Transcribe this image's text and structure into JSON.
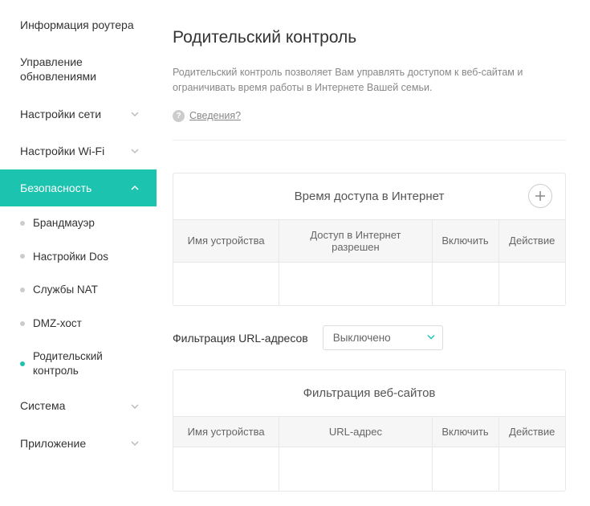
{
  "sidebar": {
    "items": [
      {
        "label": "Информация роутера",
        "type": "plain"
      },
      {
        "label": "Управление обновлениями",
        "type": "plain"
      },
      {
        "label": "Настройки сети",
        "type": "expand"
      },
      {
        "label": "Настройки Wi-Fi",
        "type": "expand"
      },
      {
        "label": "Безопасность",
        "type": "expand",
        "active": true
      },
      {
        "label": "Брандмауэр",
        "type": "sub"
      },
      {
        "label": "Настройки Dos",
        "type": "sub"
      },
      {
        "label": "Службы NAT",
        "type": "sub"
      },
      {
        "label": "DMZ-хост",
        "type": "sub"
      },
      {
        "label": "Родительский контроль",
        "type": "sub",
        "current": true
      },
      {
        "label": "Система",
        "type": "expand"
      },
      {
        "label": "Приложение",
        "type": "expand"
      }
    ]
  },
  "page": {
    "title": "Родительский контроль",
    "description": "Родительский контроль позволяет Вам управлять доступом к веб-сайтам и ограничивать время работы в Интернете Вашей семьи.",
    "info_link": "Сведения?"
  },
  "panel1": {
    "title": "Время доступа в Интернет",
    "columns": [
      "Имя устройства",
      "Доступ в Интернет разрешен",
      "Включить",
      "Действие"
    ]
  },
  "url_filter": {
    "label": "Фильтрация URL-адресов",
    "value": "Выключено"
  },
  "panel2": {
    "title": "Фильтрация веб-сайтов",
    "columns": [
      "Имя устройства",
      "URL-адрес",
      "Включить",
      "Действие"
    ]
  }
}
